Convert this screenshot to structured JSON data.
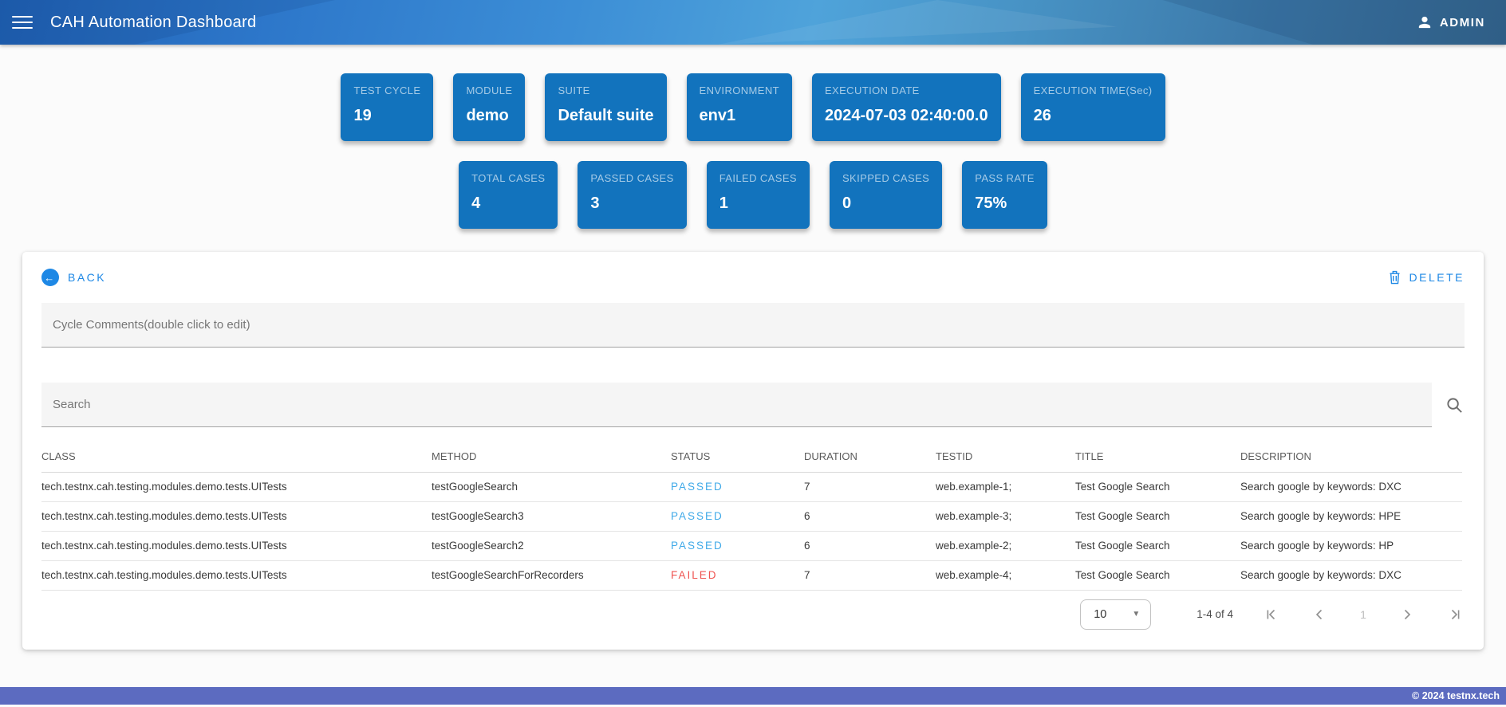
{
  "header": {
    "title": "CAH Automation Dashboard",
    "user_label": "ADMIN"
  },
  "summary_cards_row1": [
    {
      "label": "TEST CYCLE",
      "value": "19"
    },
    {
      "label": "MODULE",
      "value": "demo"
    },
    {
      "label": "SUITE",
      "value": "Default suite"
    },
    {
      "label": "ENVIRONMENT",
      "value": "env1"
    },
    {
      "label": "EXECUTION DATE",
      "value": "2024-07-03 02:40:00.0"
    },
    {
      "label": "EXECUTION TIME(Sec)",
      "value": "26"
    }
  ],
  "summary_cards_row2": [
    {
      "label": "TOTAL CASES",
      "value": "4"
    },
    {
      "label": "PASSED CASES",
      "value": "3"
    },
    {
      "label": "FAILED CASES",
      "value": "1"
    },
    {
      "label": "SKIPPED CASES",
      "value": "0"
    },
    {
      "label": "PASS RATE",
      "value": "75%"
    }
  ],
  "panel": {
    "back_label": "BACK",
    "back_arrow": "←",
    "delete_label": "DELETE",
    "comments_placeholder": "Cycle Comments(double click to edit)",
    "comments_value": "",
    "search_placeholder": "Search",
    "search_value": "",
    "table": {
      "columns": [
        "CLASS",
        "METHOD",
        "STATUS",
        "DURATION",
        "TESTID",
        "TITLE",
        "DESCRIPTION"
      ],
      "rows": [
        {
          "class": "tech.testnx.cah.testing.modules.demo.tests.UITests",
          "method": "testGoogleSearch",
          "status": "PASSED",
          "duration": "7",
          "testid": "web.example-1;",
          "title": "Test Google Search",
          "description": "Search google by keywords: DXC"
        },
        {
          "class": "tech.testnx.cah.testing.modules.demo.tests.UITests",
          "method": "testGoogleSearch3",
          "status": "PASSED",
          "duration": "6",
          "testid": "web.example-3;",
          "title": "Test Google Search",
          "description": "Search google by keywords: HPE"
        },
        {
          "class": "tech.testnx.cah.testing.modules.demo.tests.UITests",
          "method": "testGoogleSearch2",
          "status": "PASSED",
          "duration": "6",
          "testid": "web.example-2;",
          "title": "Test Google Search",
          "description": "Search google by keywords: HP"
        },
        {
          "class": "tech.testnx.cah.testing.modules.demo.tests.UITests",
          "method": "testGoogleSearchForRecorders",
          "status": "FAILED",
          "duration": "7",
          "testid": "web.example-4;",
          "title": "Test Google Search",
          "description": "Search google by keywords: DXC"
        }
      ]
    },
    "pagination": {
      "page_size": "10",
      "range_label": "1-4 of 4",
      "current_page": "1"
    }
  },
  "footer": {
    "copyright": "© 2024 testnx.tech"
  },
  "colors": {
    "card_blue": "#1273BD",
    "link_blue": "#1E88E5",
    "passed": "#3FA9E8",
    "failed": "#EF5350",
    "footer_purple": "#5C6BC0"
  }
}
